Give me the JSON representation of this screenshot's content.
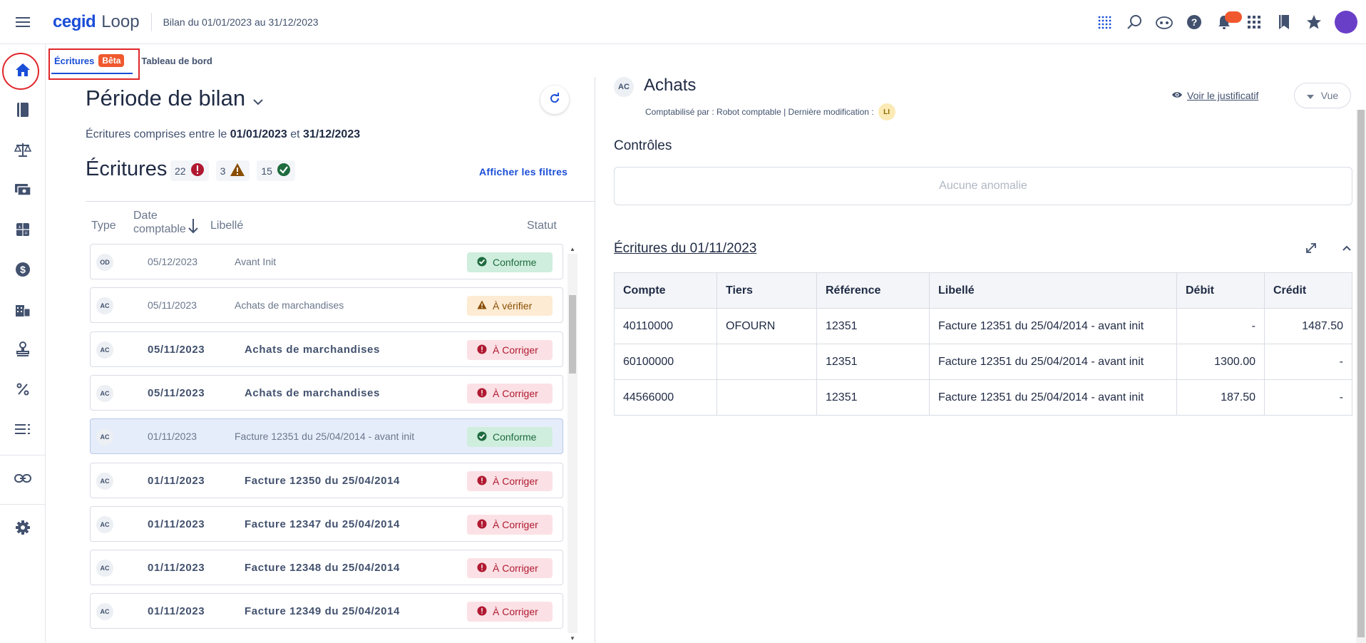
{
  "topbar": {
    "brand": "cegid",
    "product": "Loop",
    "breadcrumb": "Bilan du 01/01/2023 au 31/12/2023",
    "icons": [
      "apps-dots-icon",
      "search-icon",
      "ai-assistant-icon",
      "help-icon",
      "bell-icon",
      "grid-icon",
      "bookmark-icon",
      "star-icon",
      "avatar"
    ]
  },
  "sidebar": {
    "items": [
      "home-icon",
      "book-icon",
      "balance-icon",
      "cash-icon",
      "calculator-icon",
      "dollar-icon",
      "building-icon",
      "stamp-icon",
      "percent-icon",
      "list-icon",
      "link-icon",
      "settings-icon"
    ]
  },
  "tabs": {
    "ecritures": "Écritures",
    "beta": "Bêta",
    "tableau": "Tableau de bord"
  },
  "left": {
    "period_title": "Période de bilan",
    "period_sub_prefix": "Écritures comprises entre le ",
    "period_start": "01/01/2023",
    "period_and": " et ",
    "period_end": "31/12/2023",
    "ecritures_title": "Écritures",
    "count_errors": "22",
    "count_warnings": "3",
    "count_ok": "15",
    "show_filters": "Afficher les filtres",
    "columns": {
      "type": "Type",
      "date_line1": "Date",
      "date_line2": "comptable",
      "libelle": "Libellé",
      "statut": "Statut"
    },
    "rows": [
      {
        "type": "OD",
        "date": "05/12/2023",
        "libelle": "Avant Init",
        "status": "Conforme"
      },
      {
        "type": "AC",
        "date": "05/11/2023",
        "libelle": "Achats de marchandises",
        "status": "À vérifier"
      },
      {
        "type": "AC",
        "date": "05/11/2023",
        "libelle": "Achats de marchandises",
        "status": "À Corriger"
      },
      {
        "type": "AC",
        "date": "05/11/2023",
        "libelle": "Achats de marchandises",
        "status": "À Corriger"
      },
      {
        "type": "AC",
        "date": "01/11/2023",
        "libelle": "Facture 12351 du 25/04/2014 - avant init",
        "status": "Conforme"
      },
      {
        "type": "AC",
        "date": "01/11/2023",
        "libelle": "Facture 12350 du 25/04/2014",
        "status": "À Corriger"
      },
      {
        "type": "AC",
        "date": "01/11/2023",
        "libelle": "Facture 12347 du 25/04/2014",
        "status": "À Corriger"
      },
      {
        "type": "AC",
        "date": "01/11/2023",
        "libelle": "Facture 12348 du 25/04/2014",
        "status": "À Corriger"
      },
      {
        "type": "AC",
        "date": "01/11/2023",
        "libelle": "Facture 12349 du 25/04/2014",
        "status": "À Corriger"
      }
    ]
  },
  "right": {
    "type": "AC",
    "title": "Achats",
    "meta": "Comptabilisé par : Robot comptable | Dernière modification :",
    "modifier_initials": "LI",
    "voir_justificatif": "Voir le justificatif",
    "vue": "Vue",
    "controles": "Contrôles",
    "aucune_anomalie": "Aucune anomalie",
    "ecritures_du": "Écritures du 01/11/2023",
    "table_headers": [
      "Compte",
      "Tiers",
      "Référence",
      "Libellé",
      "Débit",
      "Crédit"
    ],
    "table_rows": [
      [
        "40110000",
        "OFOURN",
        "12351",
        "Facture 12351 du 25/04/2014 - avant init",
        "-",
        "1487.50"
      ],
      [
        "60100000",
        "",
        "12351",
        "Facture 12351 du 25/04/2014 - avant init",
        "1300.00",
        "-"
      ],
      [
        "44566000",
        "",
        "12351",
        "Facture 12351 du 25/04/2014 - avant init",
        "187.50",
        "-"
      ]
    ]
  },
  "colors": {
    "brand_blue": "#1a4ed8",
    "beta_orange": "#f0582e",
    "error_red": "#b01931",
    "warning_orange": "#8a4d00",
    "ok_green": "#1e6b3f",
    "highlight_red": "#e0262b"
  }
}
